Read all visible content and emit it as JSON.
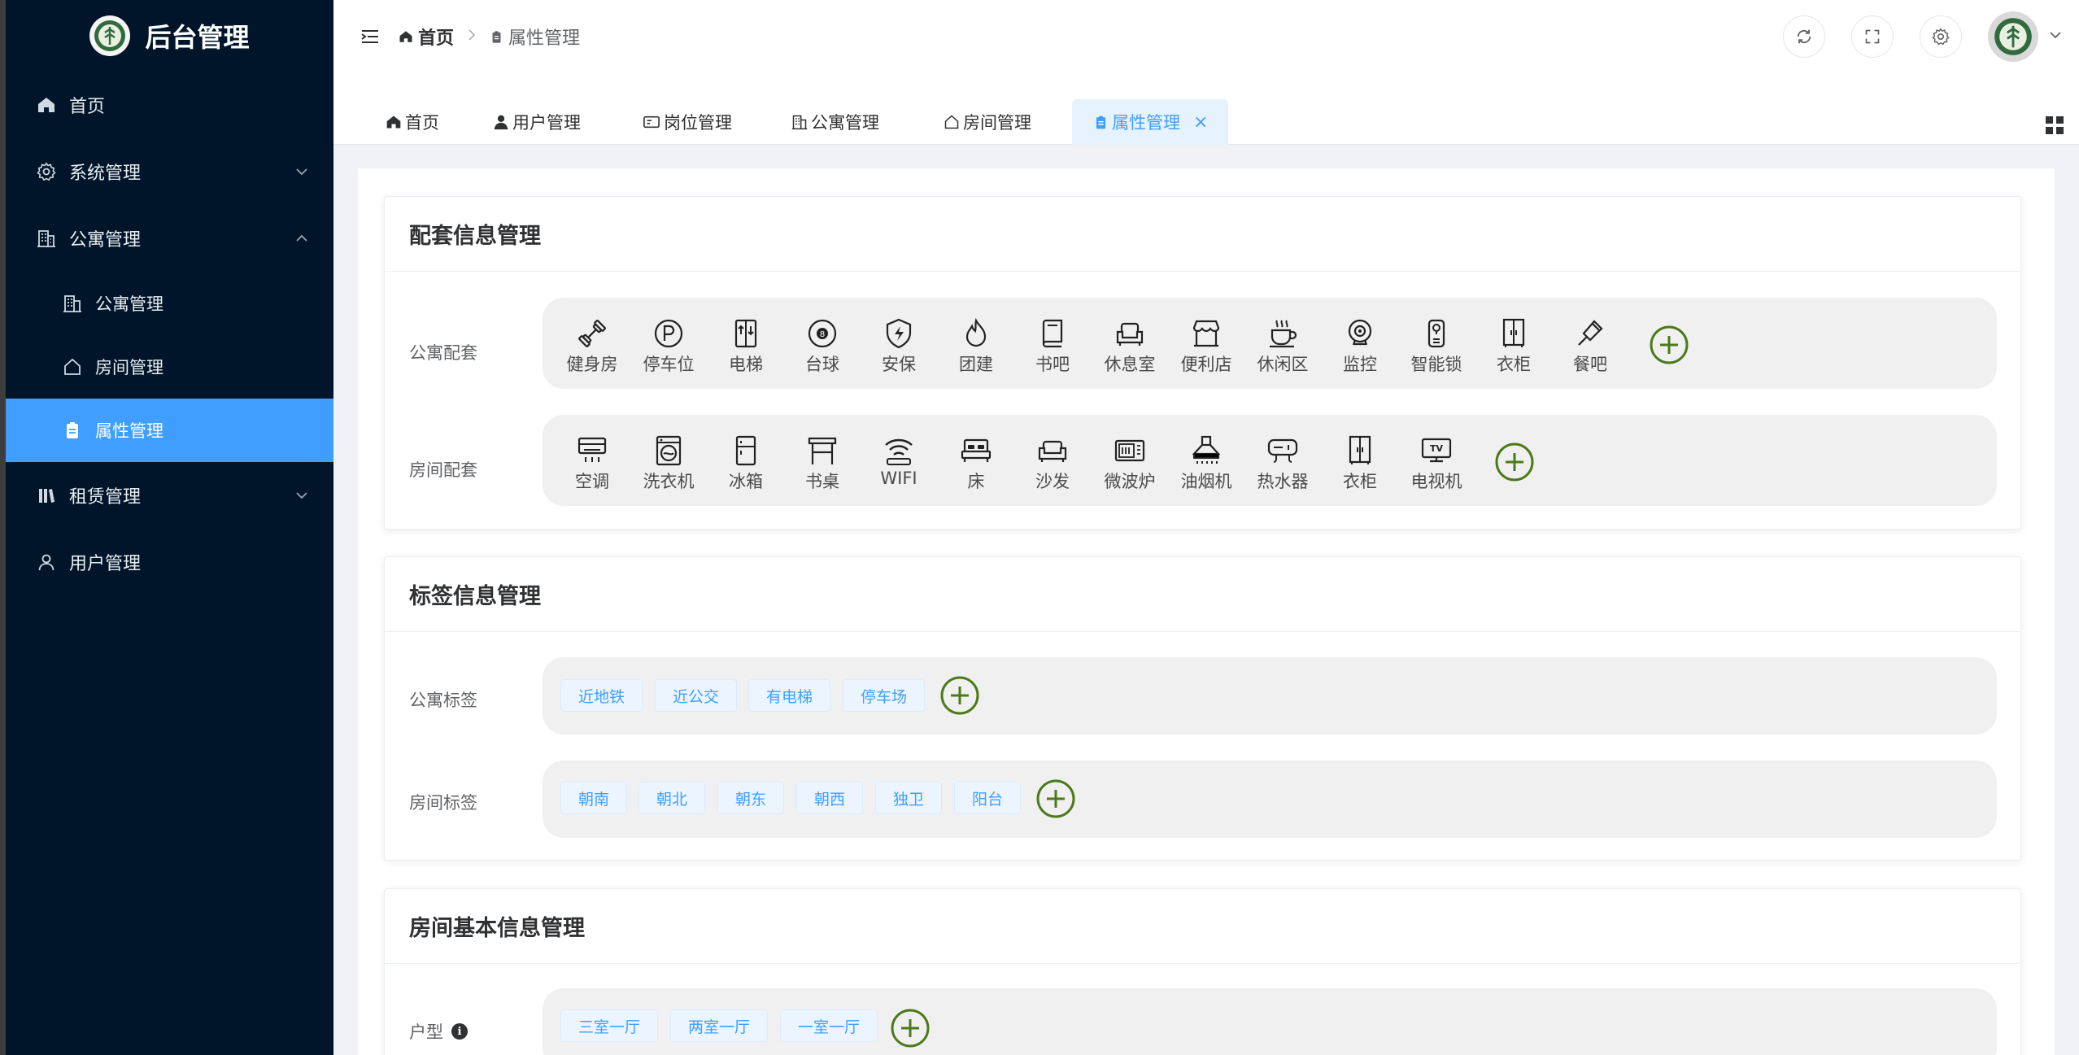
{
  "app": {
    "title": "后台管理"
  },
  "sidebar": {
    "items": [
      {
        "label": "首页",
        "icon": "home-icon"
      },
      {
        "label": "系统管理",
        "icon": "gear-icon"
      },
      {
        "label": "公寓管理",
        "icon": "building-icon"
      },
      {
        "label": "公寓管理",
        "icon": "building-icon"
      },
      {
        "label": "房间管理",
        "icon": "house-icon"
      },
      {
        "label": "属性管理",
        "icon": "clipboard-icon"
      },
      {
        "label": "租赁管理",
        "icon": "books-icon"
      },
      {
        "label": "用户管理",
        "icon": "user-icon"
      }
    ]
  },
  "breadcrumb": {
    "home": "首页",
    "current": "属性管理"
  },
  "tabs": [
    {
      "label": "首页",
      "icon": "home-icon"
    },
    {
      "label": "用户管理",
      "icon": "user-icon"
    },
    {
      "label": "岗位管理",
      "icon": "id-card-icon"
    },
    {
      "label": "公寓管理",
      "icon": "building-icon"
    },
    {
      "label": "房间管理",
      "icon": "house-icon"
    },
    {
      "label": "属性管理",
      "icon": "clipboard-icon",
      "close": "×"
    }
  ],
  "colors": {
    "sidebar_bg": "#001529",
    "active": "#409eff",
    "add_button": "#4b7a1a"
  },
  "cards": {
    "facilities": {
      "title": "配套信息管理",
      "apartment_label": "公寓配套",
      "apartment_items": [
        "健身房",
        "停车位",
        "电梯",
        "台球",
        "安保",
        "团建",
        "书吧",
        "休息室",
        "便利店",
        "休闲区",
        "监控",
        "智能锁",
        "衣柜",
        "餐吧"
      ],
      "room_label": "房间配套",
      "room_items": [
        "空调",
        "洗衣机",
        "冰箱",
        "书桌",
        "WIFI",
        "床",
        "沙发",
        "微波炉",
        "油烟机",
        "热水器",
        "衣柜",
        "电视机"
      ]
    },
    "labels": {
      "title": "标签信息管理",
      "apartment_label": "公寓标签",
      "apartment_tags": [
        "近地铁",
        "近公交",
        "有电梯",
        "停车场"
      ],
      "room_label": "房间标签",
      "room_tags": [
        "朝南",
        "朝北",
        "朝东",
        "朝西",
        "独卫",
        "阳台"
      ]
    },
    "basic": {
      "title": "房间基本信息管理",
      "layout_label": "户型",
      "info_glyph": "i",
      "layout_tags": [
        "三室一厅",
        "两室一厅",
        "一室一厅"
      ]
    }
  }
}
